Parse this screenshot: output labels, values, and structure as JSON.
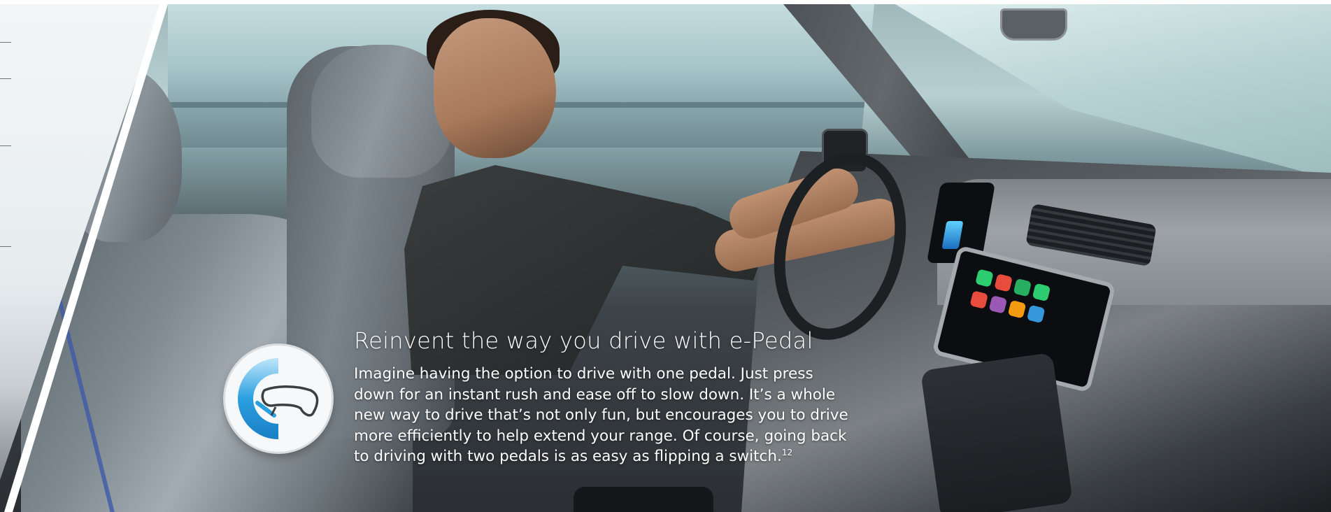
{
  "feature": {
    "headline": "Reinvent the way you drive with e-Pedal",
    "body_lines": [
      "Imagine having the option to drive with one pedal. Just press",
      "down for an instant rush and ease off to slow down. It’s a whole",
      "new way to drive that’s not only fun, but encourages you to drive",
      "more efficiently to help extend your range. Of course, going back",
      "to driving with two pedals is as easy as flipping a switch."
    ],
    "footnote": "12",
    "icon": "e-pedal-icon"
  },
  "colors": {
    "text": "#ffffff",
    "icon_blue": "#2a9fe0",
    "icon_blue_light": "#8fd1f5",
    "badge_bg": "#f7f8f9"
  }
}
